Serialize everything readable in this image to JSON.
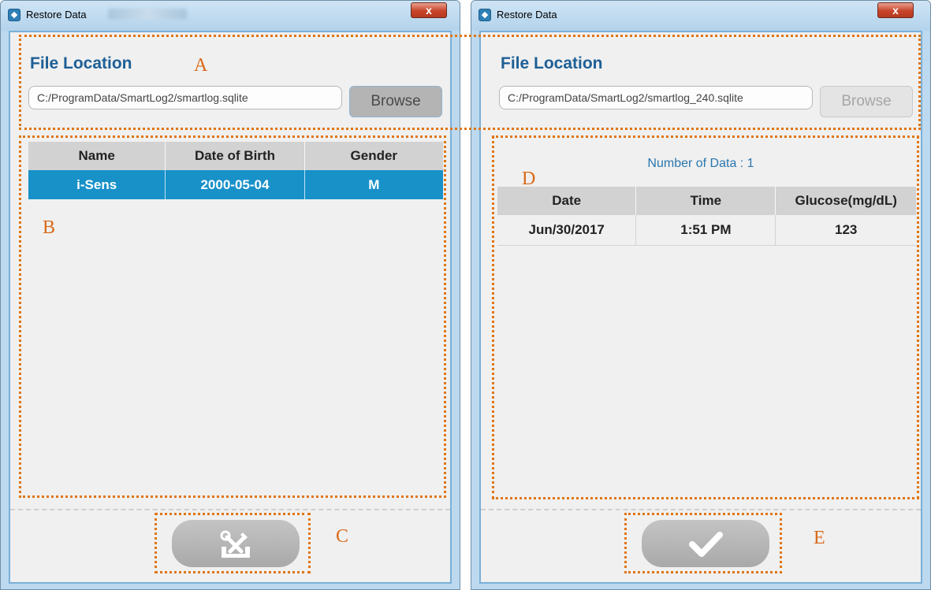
{
  "left_window": {
    "title": "Restore Data",
    "close_label": "x",
    "file_location": {
      "heading": "File Location",
      "path": "C:/ProgramData/SmartLog2/smartlog.sqlite",
      "browse_label": "Browse"
    },
    "patients": {
      "columns": [
        "Name",
        "Date of Birth",
        "Gender"
      ],
      "rows": [
        [
          "i-Sens",
          "2000-05-04",
          "M"
        ]
      ]
    },
    "action_icon": "restore-tools-icon"
  },
  "right_window": {
    "title": "Restore Data",
    "close_label": "x",
    "file_location": {
      "heading": "File Location",
      "path": "C:/ProgramData/SmartLog2/smartlog_240.sqlite",
      "browse_label": "Browse"
    },
    "data_count": "Number of Data : 1",
    "readings": {
      "columns": [
        "Date",
        "Time",
        "Glucose(mg/dL)"
      ],
      "rows": [
        [
          "Jun/30/2017",
          "1:51 PM",
          "123"
        ]
      ]
    },
    "action_icon": "checkmark-icon"
  },
  "annotations": {
    "a": "A",
    "b": "B",
    "c": "C",
    "d": "D",
    "e": "E"
  },
  "colors": {
    "accent_blue": "#1d5f96",
    "selected_row": "#1891c9",
    "annotation_orange": "#e07512",
    "window_frame": "#bcd9ef"
  }
}
